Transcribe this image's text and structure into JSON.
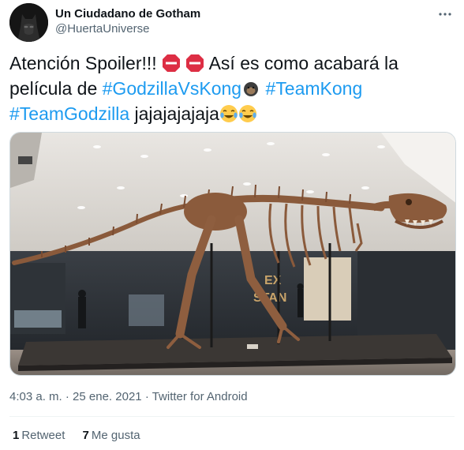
{
  "author": {
    "display_name": "Un Ciudadano de Gotham",
    "handle": "@HuertaUniverse",
    "avatar_icon": "batman-avatar-icon"
  },
  "tweet": {
    "text_part1": "Atención Spoiler!!!",
    "text_part2": "Así es como acabará la película de",
    "hashtag1": "#GodzillaVsKong",
    "hashtag2": "#TeamKong",
    "hashtag3": "#TeamGodzilla",
    "text_part3": "jajajajajaja",
    "emojis": [
      "stop-sign-emoji",
      "stop-sign-emoji",
      "gorilla-emoji",
      "crying-laughing-emoji",
      "crying-laughing-emoji"
    ],
    "media_description_icon": "t-rex-skeleton-photo"
  },
  "meta": {
    "time": "4:03 a. m.",
    "separator": "·",
    "date": "25 ene. 2021",
    "source": "Twitter for Android"
  },
  "stats": {
    "retweets_count": "1",
    "retweets_label": "Retweet",
    "likes_count": "7",
    "likes_label": "Me gusta"
  },
  "colors": {
    "link": "#1d9bf0",
    "secondary_text": "#536471",
    "primary_text": "#0f1419",
    "divider": "#eff3f4"
  }
}
